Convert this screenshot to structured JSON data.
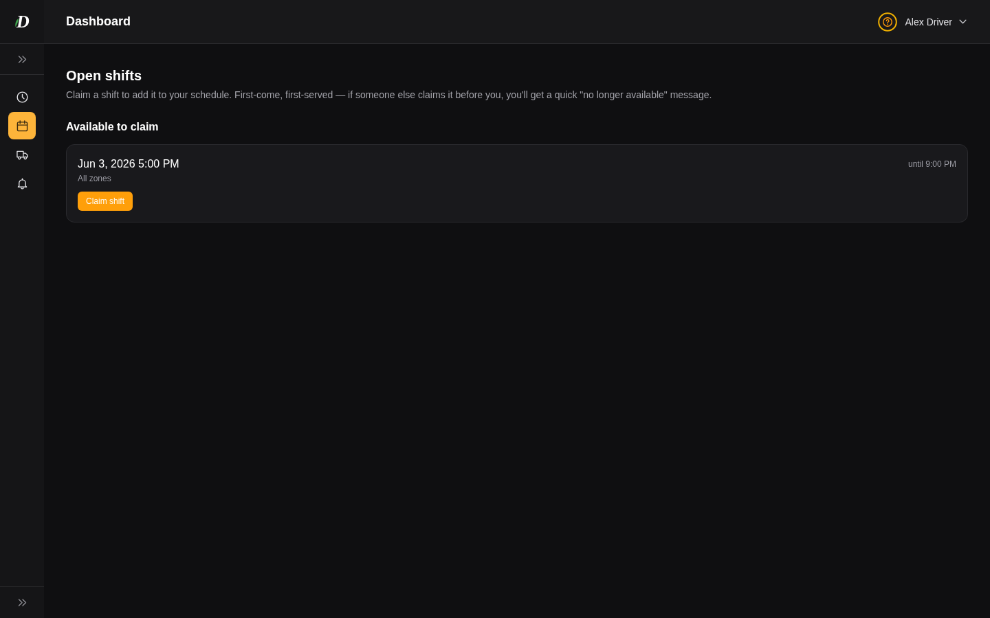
{
  "sidebar": {
    "logo_text": "D",
    "nav_items": [
      {
        "kind": "clock",
        "selected": false
      },
      {
        "kind": "calendar",
        "selected": true
      },
      {
        "kind": "truck",
        "selected": false
      },
      {
        "kind": "bell",
        "selected": false
      }
    ]
  },
  "header": {
    "title": "Dashboard",
    "user_name": "Alex Driver"
  },
  "page": {
    "title": "Open shifts",
    "description": "Claim a shift to add it to your schedule. First-come, first-served — if someone else claims it before you, you'll get a quick \"no longer available\" message.",
    "section_title": "Available to claim"
  },
  "shifts": [
    {
      "start": "Jun 3, 2026 5:00 PM",
      "zone": "All zones",
      "end": "until 9:00 PM",
      "action": "Claim shift"
    }
  ]
}
